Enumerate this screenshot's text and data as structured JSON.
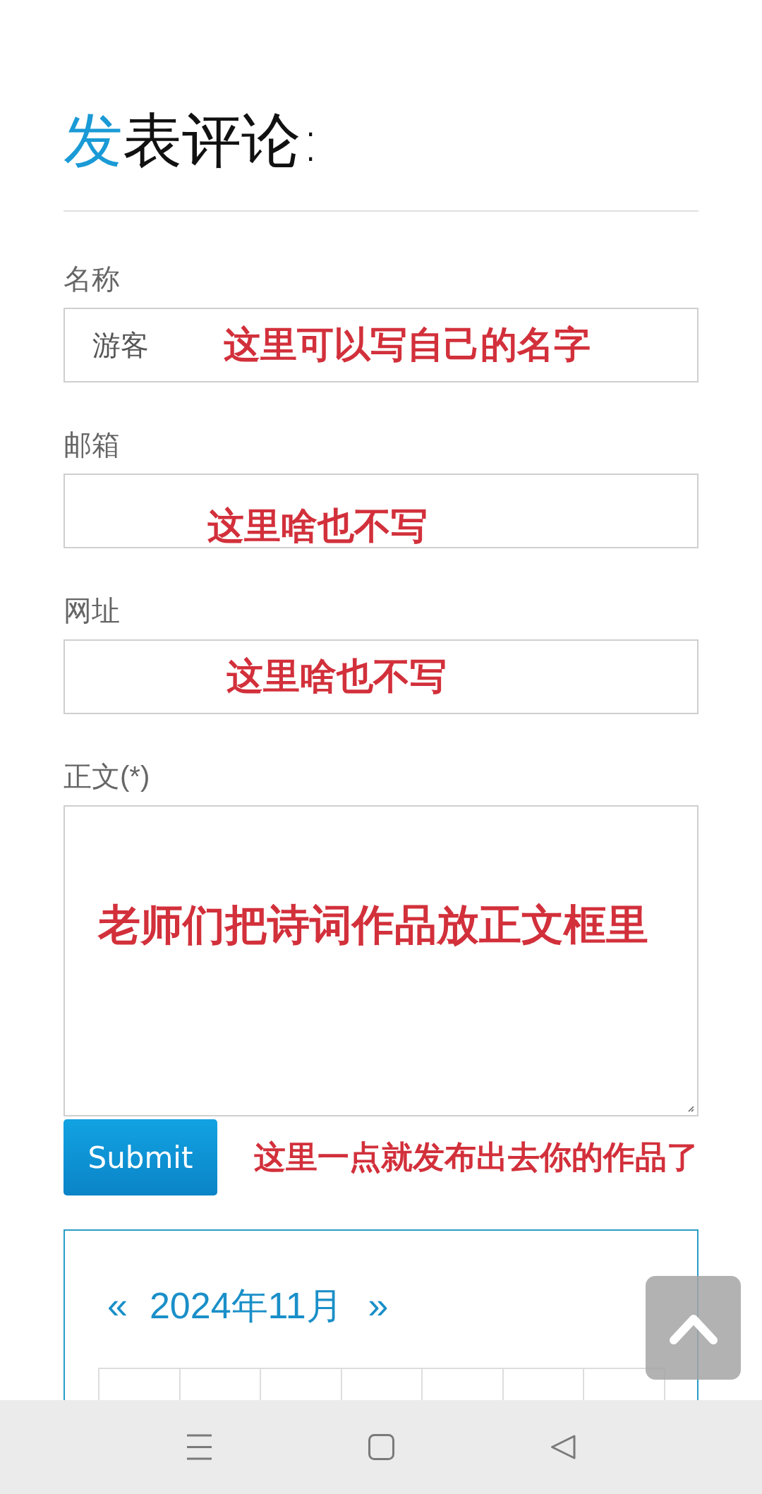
{
  "title": "发表评论:",
  "fields": [
    {
      "kind": "input",
      "label": "名称",
      "value": "游客",
      "annotation": "这里可以写自己的名字"
    },
    {
      "kind": "input",
      "label": "邮箱",
      "annotation": "这里啥也不写"
    },
    {
      "kind": "input",
      "label": "网址",
      "annotation": "这里啥也不写"
    },
    {
      "kind": "textarea",
      "label": "正文(*)",
      "annotation": "老师们把诗词作品放正文框里"
    }
  ],
  "submit": {
    "label": "Submit",
    "annotation": "这里一点就发布出去你的作品了"
  },
  "calendar": {
    "prev": "«",
    "month": "2024年11月",
    "next": "»"
  }
}
